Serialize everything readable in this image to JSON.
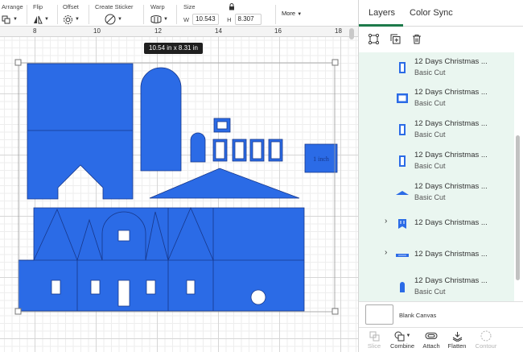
{
  "toolbar": {
    "arrange": "Arrange",
    "flip": "Flip",
    "offset": "Offset",
    "create_sticker": "Create Sticker",
    "warp": "Warp",
    "size": "Size",
    "width_label": "W",
    "width_value": "10.543",
    "height_label": "H",
    "height_value": "8.307",
    "more": "More"
  },
  "canvas": {
    "ruler_ticks": [
      "8",
      "10",
      "12",
      "14",
      "16",
      "18"
    ],
    "size_tooltip": "10.54  in x 8.31  in",
    "label_text": "1 inch",
    "accent_color": "#2b6be6"
  },
  "panel": {
    "tabs": [
      "Layers",
      "Color Sync"
    ],
    "active_tab_color": "#1d7a4a",
    "layers": [
      {
        "title": "12 Days Christmas ...",
        "subtitle": "Basic Cut",
        "icon": "tall-rect"
      },
      {
        "title": "12 Days Christmas ...",
        "subtitle": "Basic Cut",
        "icon": "wide-rect"
      },
      {
        "title": "12 Days Christmas ...",
        "subtitle": "Basic Cut",
        "icon": "tall-rect"
      },
      {
        "title": "12 Days Christmas ...",
        "subtitle": "Basic Cut",
        "icon": "tall-rect"
      },
      {
        "title": "12 Days Christmas ...",
        "subtitle": "Basic Cut",
        "icon": "roof"
      },
      {
        "title": "12 Days Christmas ...",
        "subtitle": "",
        "icon": "banner-group"
      },
      {
        "title": "12 Days Christmas ...",
        "subtitle": "",
        "icon": "strip-group"
      },
      {
        "title": "12 Days Christmas ...",
        "subtitle": "Basic Cut",
        "icon": "arch"
      }
    ],
    "blank_canvas": "Blank Canvas",
    "bottom_tools": {
      "slice": "Slice",
      "combine": "Combine",
      "attach": "Attach",
      "flatten": "Flatten",
      "contour": "Contour"
    }
  }
}
